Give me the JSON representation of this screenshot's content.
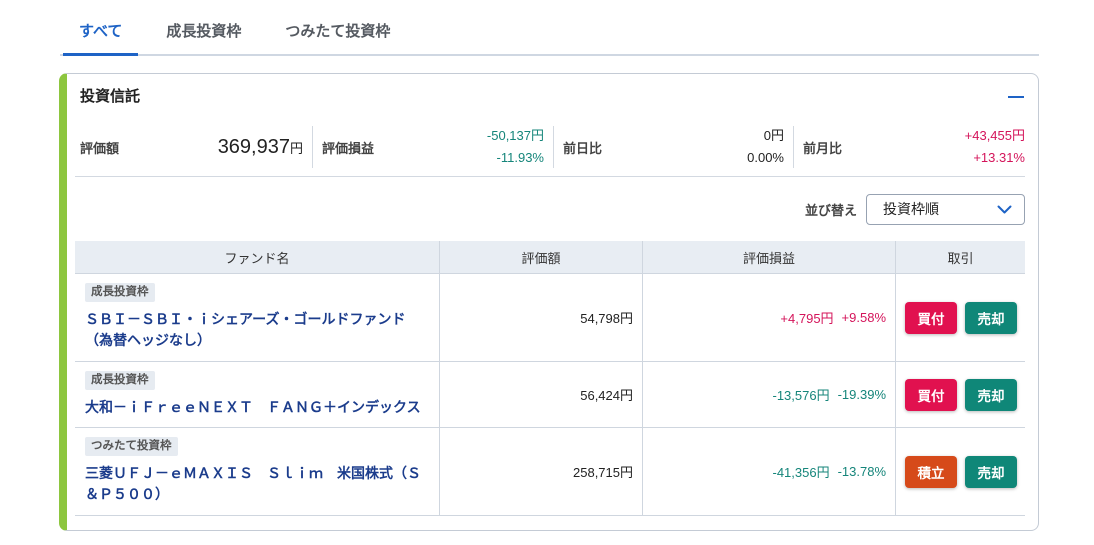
{
  "tabs": [
    {
      "label": "すべて",
      "active": true
    },
    {
      "label": "成長投資枠",
      "active": false
    },
    {
      "label": "つみたて投資枠",
      "active": false
    }
  ],
  "card": {
    "title": "投資信託",
    "collapse_icon": "minus-icon"
  },
  "summary": {
    "valuation": {
      "label": "評価額",
      "value": "369,937",
      "unit": "円"
    },
    "profit_loss": {
      "label": "評価損益",
      "amount": "-50,137円",
      "percent": "-11.93%",
      "color": "#15857a"
    },
    "day_change": {
      "label": "前日比",
      "amount": "0円",
      "percent": "0.00%",
      "color": "#222222"
    },
    "month_change": {
      "label": "前月比",
      "amount": "+43,455円",
      "percent": "+13.31%",
      "color": "#d4145a"
    }
  },
  "sort": {
    "label": "並び替え",
    "selected": "投資枠順",
    "icon": "chevron-down-icon"
  },
  "table": {
    "headers": [
      "ファンド名",
      "評価額",
      "評価損益",
      "取引"
    ],
    "rows": [
      {
        "badge": "成長投資枠",
        "name": "ＳＢＩ－ＳＢＩ・ｉシェアーズ・ゴールドファンド（為替ヘッジなし）",
        "value": "54,798円",
        "pl_amount": "+4,795円",
        "pl_percent": "+9.58%",
        "pl_color": "#d4145a",
        "actions": [
          {
            "label": "買付",
            "color": "#e1114f"
          },
          {
            "label": "売却",
            "color": "#0f8778"
          }
        ]
      },
      {
        "badge": "成長投資枠",
        "name": "大和－ｉＦｒｅｅＮＥＸＴ　ＦＡＮＧ＋インデックス",
        "value": "56,424円",
        "pl_amount": "-13,576円",
        "pl_percent": "-19.39%",
        "pl_color": "#15857a",
        "actions": [
          {
            "label": "買付",
            "color": "#e1114f"
          },
          {
            "label": "売却",
            "color": "#0f8778"
          }
        ]
      },
      {
        "badge": "つみたて投資枠",
        "name": "三菱ＵＦＪ－ｅＭＡＸＩＳ　Ｓｌｉｍ　米国株式（Ｓ＆Ｐ５００）",
        "value": "258,715円",
        "pl_amount": "-41,356円",
        "pl_percent": "-13.78%",
        "pl_color": "#15857a",
        "actions": [
          {
            "label": "積立",
            "color": "#d64a1a"
          },
          {
            "label": "売却",
            "color": "#0f8778"
          }
        ]
      }
    ]
  },
  "colors": {
    "primary": "#1e63c6",
    "accent": "#8dc63f",
    "fund_name": "#1b3c8c"
  }
}
